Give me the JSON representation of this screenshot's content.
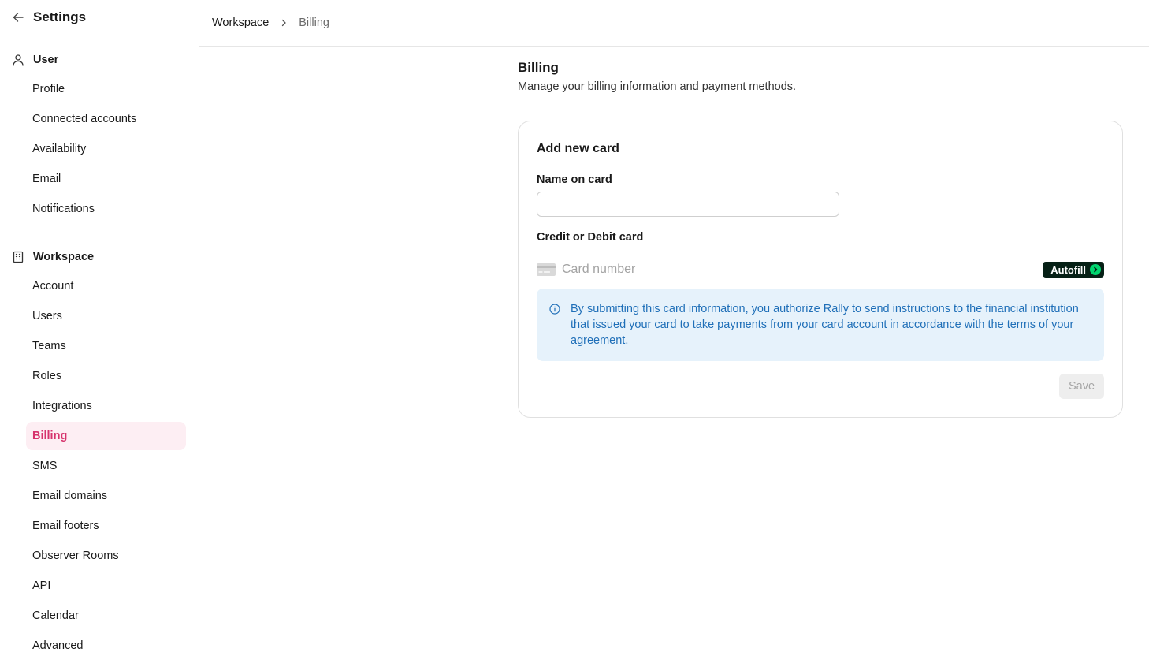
{
  "sidebar": {
    "title": "Settings",
    "sections": [
      {
        "label": "User",
        "icon": "user-icon",
        "items": [
          "Profile",
          "Connected accounts",
          "Availability",
          "Email",
          "Notifications"
        ]
      },
      {
        "label": "Workspace",
        "icon": "building-icon",
        "items": [
          "Account",
          "Users",
          "Teams",
          "Roles",
          "Integrations",
          "Billing",
          "SMS",
          "Email domains",
          "Email footers",
          "Observer Rooms",
          "API",
          "Calendar",
          "Advanced"
        ]
      }
    ],
    "active_item": "Billing"
  },
  "breadcrumb": {
    "parent": "Workspace",
    "current": "Billing"
  },
  "page": {
    "title": "Billing",
    "description": "Manage your billing information and payment methods."
  },
  "card_form": {
    "title": "Add new card",
    "name_label": "Name on card",
    "name_value": "",
    "card_label": "Credit or Debit card",
    "card_number_placeholder": "Card number",
    "autofill_label": "Autofill",
    "notice_text": "By submitting this card information, you authorize Rally to send instructions to the financial institution that issued your card to take payments from your card account in accordance with the terms of your agreement.",
    "save_label": "Save"
  },
  "colors": {
    "accent": "#d6336c",
    "active_bg": "#fdeef3",
    "notice_bg": "#e6f2fb",
    "notice_text": "#1f6fb8",
    "autofill_bg": "#062016",
    "autofill_arrow": "#00d66f"
  }
}
